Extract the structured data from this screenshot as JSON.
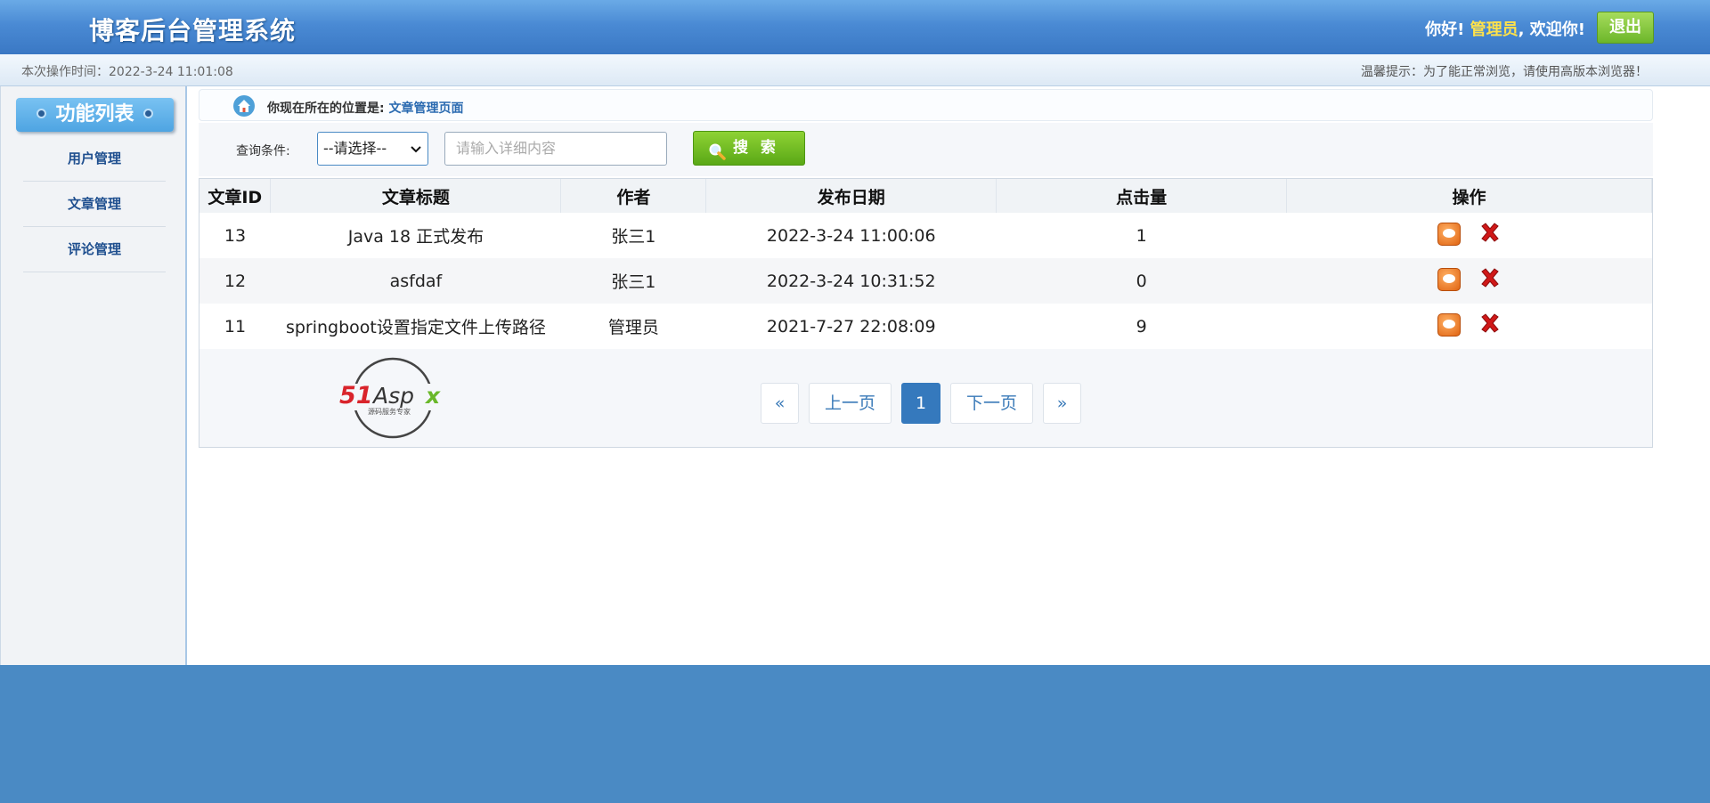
{
  "header": {
    "title": "博客后台管理系统",
    "greet_prefix": "你好!",
    "user": "管理员",
    "greet_suffix": ", 欢迎你!",
    "logout": "退出"
  },
  "infobar": {
    "time": "本次操作时间：2022-3-24 11:01:08",
    "tip": "温馨提示：为了能正常浏览，请使用高版本浏览器！"
  },
  "sidebar": {
    "title": "功能列表",
    "items": [
      {
        "label": "用户管理"
      },
      {
        "label": "文章管理"
      },
      {
        "label": "评论管理"
      }
    ]
  },
  "breadcrumb": {
    "prefix": "你现在所在的位置是:",
    "current": "文章管理页面"
  },
  "search": {
    "label": "查询条件:",
    "select_value": "--请选择--",
    "placeholder": "请输入详细内容",
    "button": "搜 索"
  },
  "table": {
    "columns": [
      "文章ID",
      "文章标题",
      "作者",
      "发布日期",
      "点击量",
      "操作"
    ],
    "rows": [
      {
        "id": "13",
        "title": "Java 18 正式发布",
        "author": "张三1",
        "date": "2022-3-24 11:00:06",
        "clicks": "1"
      },
      {
        "id": "12",
        "title": "asfdaf",
        "author": "张三1",
        "date": "2022-3-24 10:31:52",
        "clicks": "0"
      },
      {
        "id": "11",
        "title": "springboot设置指定文件上传路径",
        "author": "管理员",
        "date": "2021-7-27 22:08:09",
        "clicks": "9"
      }
    ]
  },
  "watermark": {
    "brand": "51Aspx",
    "tagline": "源码服务专家"
  },
  "pagination": {
    "first": "«",
    "prev": "上一页",
    "current": "1",
    "next": "下一页",
    "last": "»"
  },
  "colors": {
    "header": "#4a8ad4",
    "accent_green": "#6cb62a",
    "link_blue": "#2a6ab0",
    "footer": "#4a8ac4"
  }
}
